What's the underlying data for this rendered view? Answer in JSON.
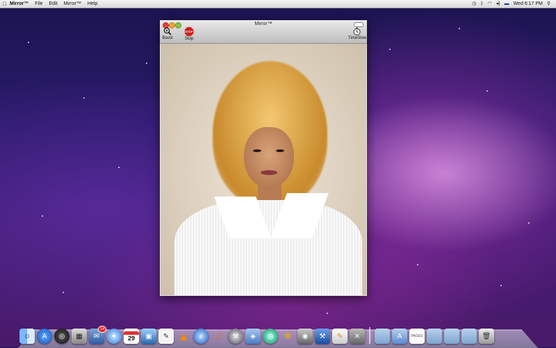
{
  "menubar": {
    "apple_icon": "apple-icon",
    "app_name": "Mirror™",
    "items": [
      "File",
      "Edit",
      "Mirror™",
      "Help"
    ],
    "clock": "Wed 6:17 PM",
    "status_icons": [
      "time-machine-icon",
      "bluetooth-icon",
      "wifi-icon",
      "volume-icon",
      "flag-icon",
      "spotlight-icon"
    ]
  },
  "window": {
    "title": "Mirror™",
    "toolbar": {
      "boost_label": "Boost",
      "stop_label": "Stop",
      "stop_sign_text": "STOP",
      "timeslow_label": "TimeSlow"
    }
  },
  "dock": {
    "calendar_day": "29",
    "mail_badge": "14",
    "icons": [
      "finder-icon",
      "app-store-icon",
      "dashboard-icon",
      "preview-icon",
      "mail-icon",
      "safari-icon",
      "ical-icon",
      "iphoto-icon",
      "textedit-icon",
      "vlc-icon",
      "itunes-icon",
      "garageband-icon",
      "xcode-icon",
      "preview2-icon",
      "time-machine-icon",
      "mirror-icon",
      "camera-icon",
      "xcode-hammer-icon",
      "pages-icon",
      "utilities-icon",
      "folder-icon",
      "documents-icon",
      "pages-doc-icon",
      "downloads-folder-icon",
      "applications-folder-icon",
      "stack-folder-icon",
      "trash-icon"
    ]
  },
  "colors": {
    "stop_red": "#d21e1e",
    "close_red": "#e0443e",
    "minimize_yellow": "#e9a436",
    "zoom_green": "#8cc44a"
  }
}
